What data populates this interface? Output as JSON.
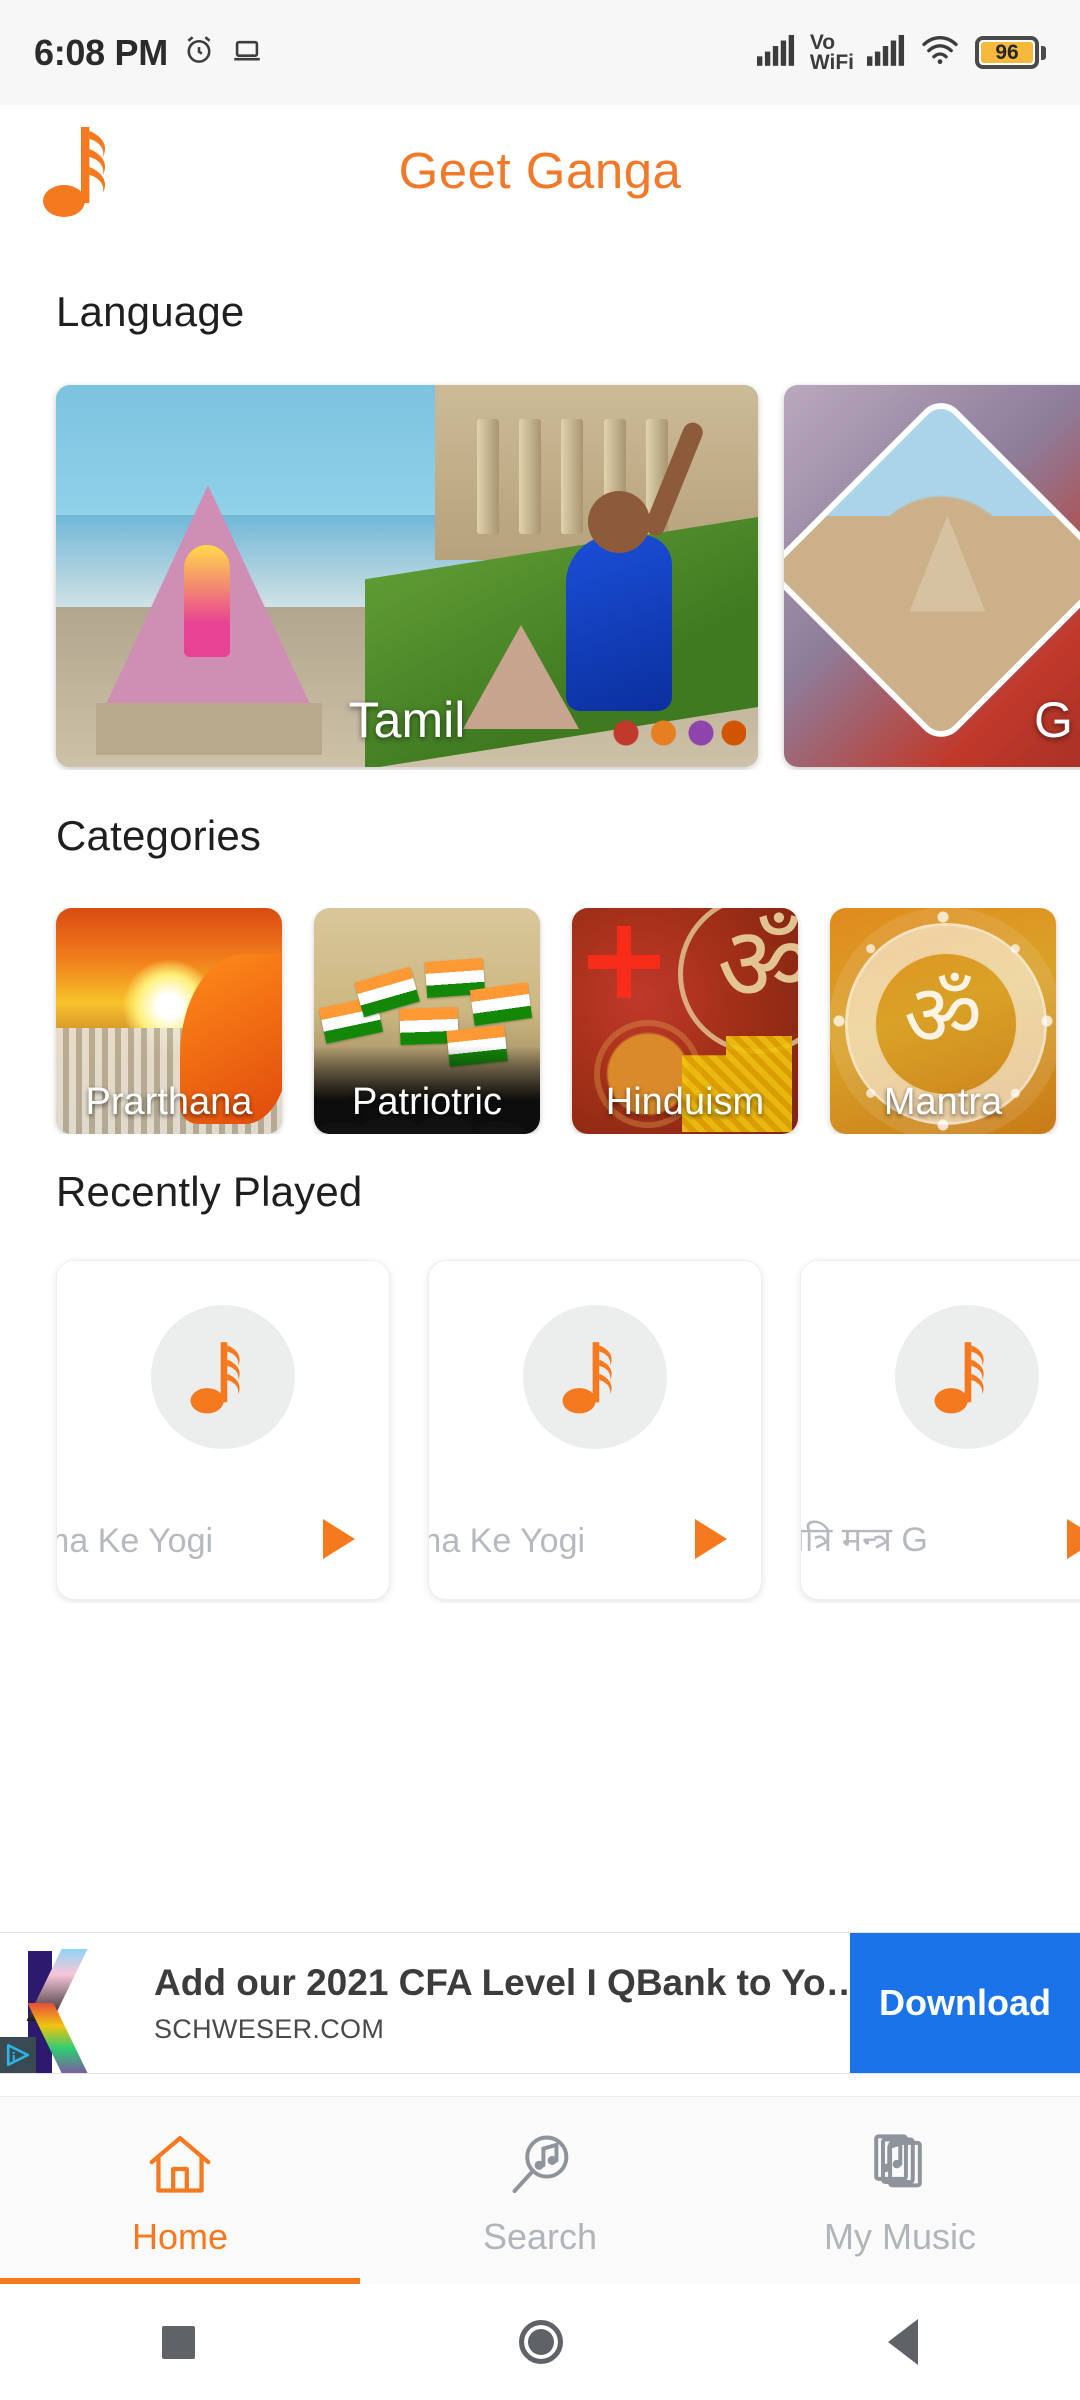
{
  "status_bar": {
    "time": "6:08 PM",
    "alarm_icon": "alarm-clock-icon",
    "cast_icon": "laptop-cast-icon",
    "signal_icon": "signal-bars-icon",
    "volte_line1": "Vo",
    "volte_line2": "WiFi",
    "signal2_icon": "signal-bars-icon",
    "wifi_icon": "wifi-icon",
    "battery_level": "96"
  },
  "app_bar": {
    "logo_icon": "music-note-logo-icon",
    "title": "Geet Ganga",
    "accent_color": "#f07a2a"
  },
  "language_section": {
    "title": "Language",
    "cards": [
      {
        "label": "Tamil"
      },
      {
        "label": "G"
      }
    ]
  },
  "categories_section": {
    "title": "Categories",
    "cards": [
      {
        "label": "Prarthana"
      },
      {
        "label": "Patriotric"
      },
      {
        "label": "Hinduism"
      },
      {
        "label": "Mantra"
      }
    ]
  },
  "recently_played_section": {
    "title": "Recently Played",
    "cards": [
      {
        "title": "ma Ke Yogi",
        "thumb_icon": "music-note-icon",
        "play_icon": "play-triangle-icon"
      },
      {
        "title": "ma Ke Yogi",
        "thumb_icon": "music-note-icon",
        "play_icon": "play-triangle-icon"
      },
      {
        "title": "यत्रि मन्त्र          G",
        "thumb_icon": "music-note-icon",
        "play_icon": "play-triangle-icon"
      }
    ]
  },
  "ad_banner": {
    "adchoices_icon": "adchoices-icon",
    "advertiser_logo_icon": "schweser-k-logo-icon",
    "headline": "Add our 2021 CFA Level I QBank to Yo…",
    "domain": "SCHWESER.COM",
    "cta_label": "Download",
    "cta_color": "#1a73e8"
  },
  "bottom_nav": {
    "items": [
      {
        "label": "Home",
        "icon": "home-icon",
        "active": true
      },
      {
        "label": "Search",
        "icon": "search-music-icon",
        "active": false
      },
      {
        "label": "My Music",
        "icon": "my-music-icon",
        "active": false
      }
    ],
    "active_color": "#f4791f",
    "inactive_color": "#b0b4bb"
  },
  "system_nav": {
    "recents_icon": "recents-square-icon",
    "home_icon": "home-circle-icon",
    "back_icon": "back-triangle-icon"
  }
}
